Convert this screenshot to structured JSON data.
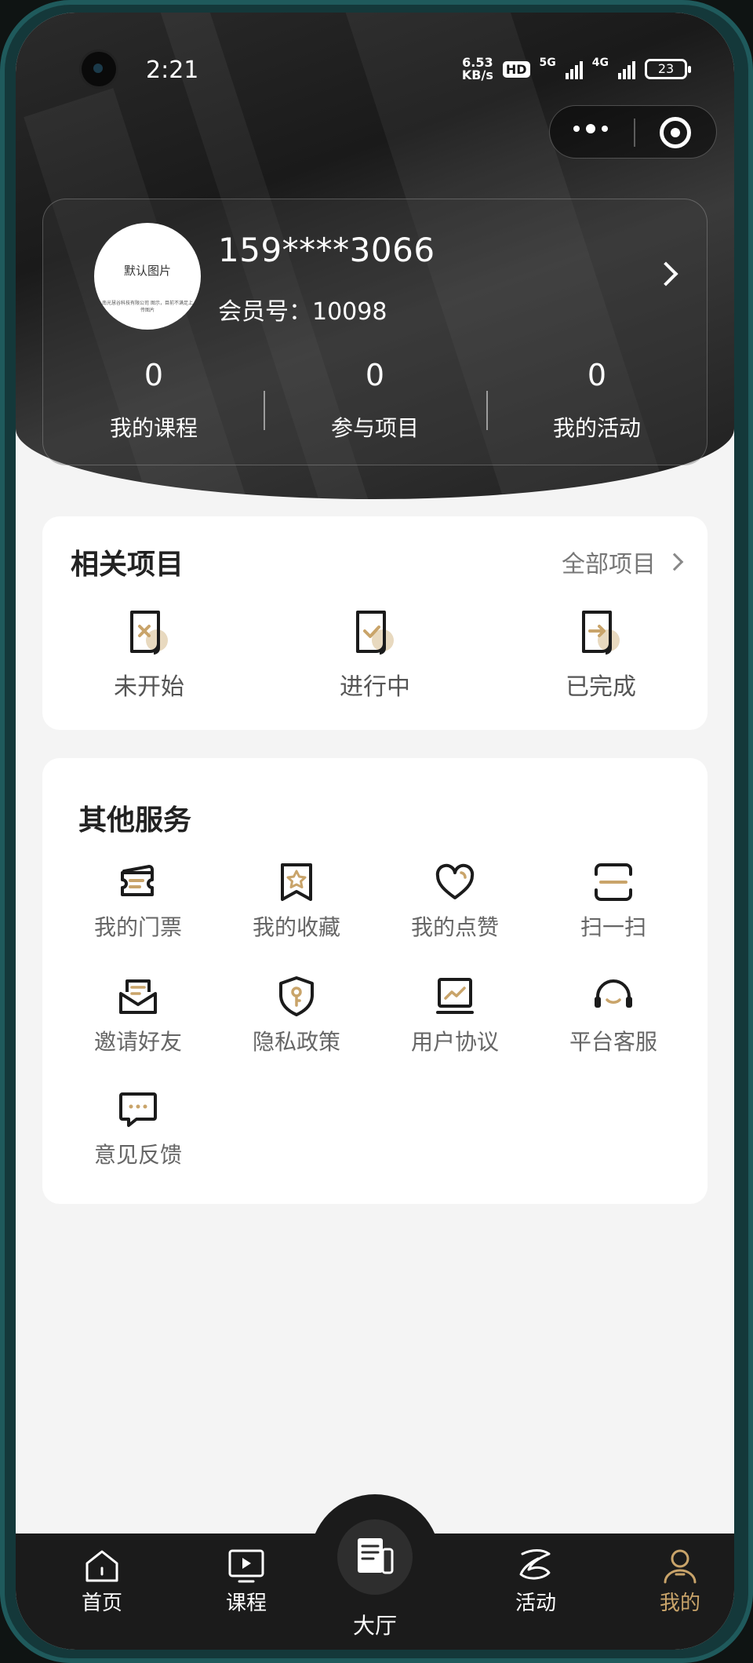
{
  "status_bar": {
    "time": "2:21",
    "net_speed_value": "6.53",
    "net_speed_unit": "KB/s",
    "hd_badge": "HD",
    "signal1_label": "5G",
    "signal2_label": "4G",
    "battery": "23"
  },
  "profile": {
    "avatar_text": "默认图片",
    "avatar_small_text": "南光慧谷科技有限公司 图示，目前不满足上传图片",
    "phone": "159****3066",
    "member_label": "会员号：",
    "member_id": "10098",
    "stats": [
      {
        "value": "0",
        "label": "我的课程"
      },
      {
        "value": "0",
        "label": "参与项目"
      },
      {
        "value": "0",
        "label": "我的活动"
      }
    ]
  },
  "projects": {
    "title": "相关项目",
    "more_label": "全部项目",
    "items": [
      {
        "label": "未开始",
        "icon": "doc-x-icon"
      },
      {
        "label": "进行中",
        "icon": "doc-check-icon"
      },
      {
        "label": "已完成",
        "icon": "doc-arrow-icon"
      }
    ]
  },
  "services": {
    "title": "其他服务",
    "items": [
      {
        "label": "我的门票",
        "icon": "ticket-icon"
      },
      {
        "label": "我的收藏",
        "icon": "bookmark-star-icon"
      },
      {
        "label": "我的点赞",
        "icon": "heart-icon"
      },
      {
        "label": "扫一扫",
        "icon": "scan-icon"
      },
      {
        "label": "邀请好友",
        "icon": "invite-mail-icon"
      },
      {
        "label": "隐私政策",
        "icon": "shield-key-icon"
      },
      {
        "label": "用户协议",
        "icon": "monitor-chart-icon"
      },
      {
        "label": "平台客服",
        "icon": "headset-icon"
      },
      {
        "label": "意见反馈",
        "icon": "chat-bubble-icon"
      }
    ]
  },
  "tabbar": {
    "items": [
      {
        "label": "首页",
        "icon": "home-icon"
      },
      {
        "label": "课程",
        "icon": "play-screen-icon"
      },
      {
        "label": "大厅",
        "icon": "newspaper-icon"
      },
      {
        "label": "活动",
        "icon": "activity-icon"
      },
      {
        "label": "我的",
        "icon": "user-icon"
      }
    ],
    "active": "我的"
  },
  "colors": {
    "accent": "#c9a46a",
    "accent_light": "#e8d9bf",
    "dark": "#1b1b1b"
  }
}
